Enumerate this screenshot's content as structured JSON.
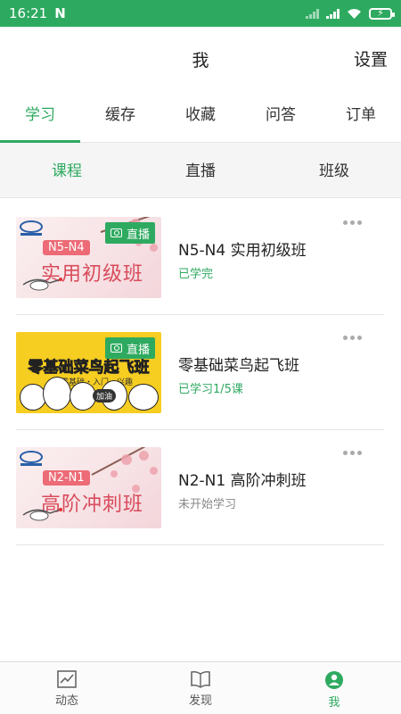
{
  "status_bar": {
    "time": "16:21",
    "carrier_icon": "N"
  },
  "header": {
    "title": "我",
    "settings_label": "设置"
  },
  "tabs": [
    {
      "label": "学习",
      "active": true
    },
    {
      "label": "缓存",
      "active": false
    },
    {
      "label": "收藏",
      "active": false
    },
    {
      "label": "问答",
      "active": false
    },
    {
      "label": "订单",
      "active": false
    }
  ],
  "subtabs": [
    {
      "label": "课程",
      "active": true
    },
    {
      "label": "直播",
      "active": false
    },
    {
      "label": "班级",
      "active": false
    }
  ],
  "courses": [
    {
      "name": "N5-N4 实用初级班",
      "status": "已学完",
      "status_color": "#2eaa60",
      "thumb_tag": "N5-N4",
      "thumb_title": "实用初级班",
      "live_badge": "直播"
    },
    {
      "name": "零基础菜鸟起飞班",
      "status": "已学习1/5课",
      "status_color": "#2eaa60",
      "thumb_title": "零基础菜鸟起飞班",
      "thumb_sub": "零基础・入门・兴趣",
      "thumb_badge": "加油",
      "live_badge": "直播"
    },
    {
      "name": "N2-N1 高阶冲刺班",
      "status": "未开始学习",
      "status_color": "#888888",
      "thumb_tag": "N2-N1",
      "thumb_title": "高阶冲刺班"
    }
  ],
  "bottom_nav": [
    {
      "label": "动态",
      "icon": "chart-line-icon",
      "active": false
    },
    {
      "label": "发现",
      "icon": "book-icon",
      "active": false
    },
    {
      "label": "我",
      "icon": "user-icon",
      "active": true
    }
  ],
  "colors": {
    "accent": "#2eaa60",
    "status_bar": "#2eaa60"
  }
}
